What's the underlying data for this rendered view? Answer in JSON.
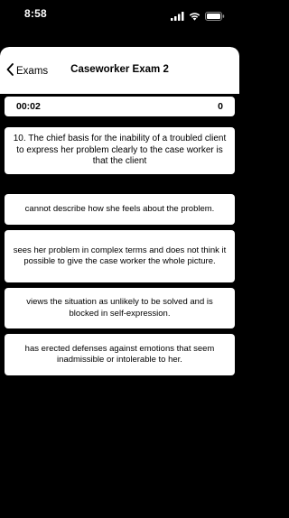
{
  "status_bar": {
    "time": "8:58"
  },
  "nav": {
    "back_label": "Exams",
    "title": "Caseworker Exam 2"
  },
  "quiz": {
    "timer": "00:02",
    "score": "0",
    "question": "10. The chief basis for the inability of a troubled client to express her problem clearly to the case worker is that the client",
    "answers": [
      "cannot describe how she feels about the problem.",
      "sees her problem in complex terms and does not think it possible to give the case worker the whole picture.",
      "views the situation as unlikely to be solved and is blocked in self-expression.",
      "has erected defenses against emotions that seem inadmissible or intolerable to her."
    ]
  }
}
